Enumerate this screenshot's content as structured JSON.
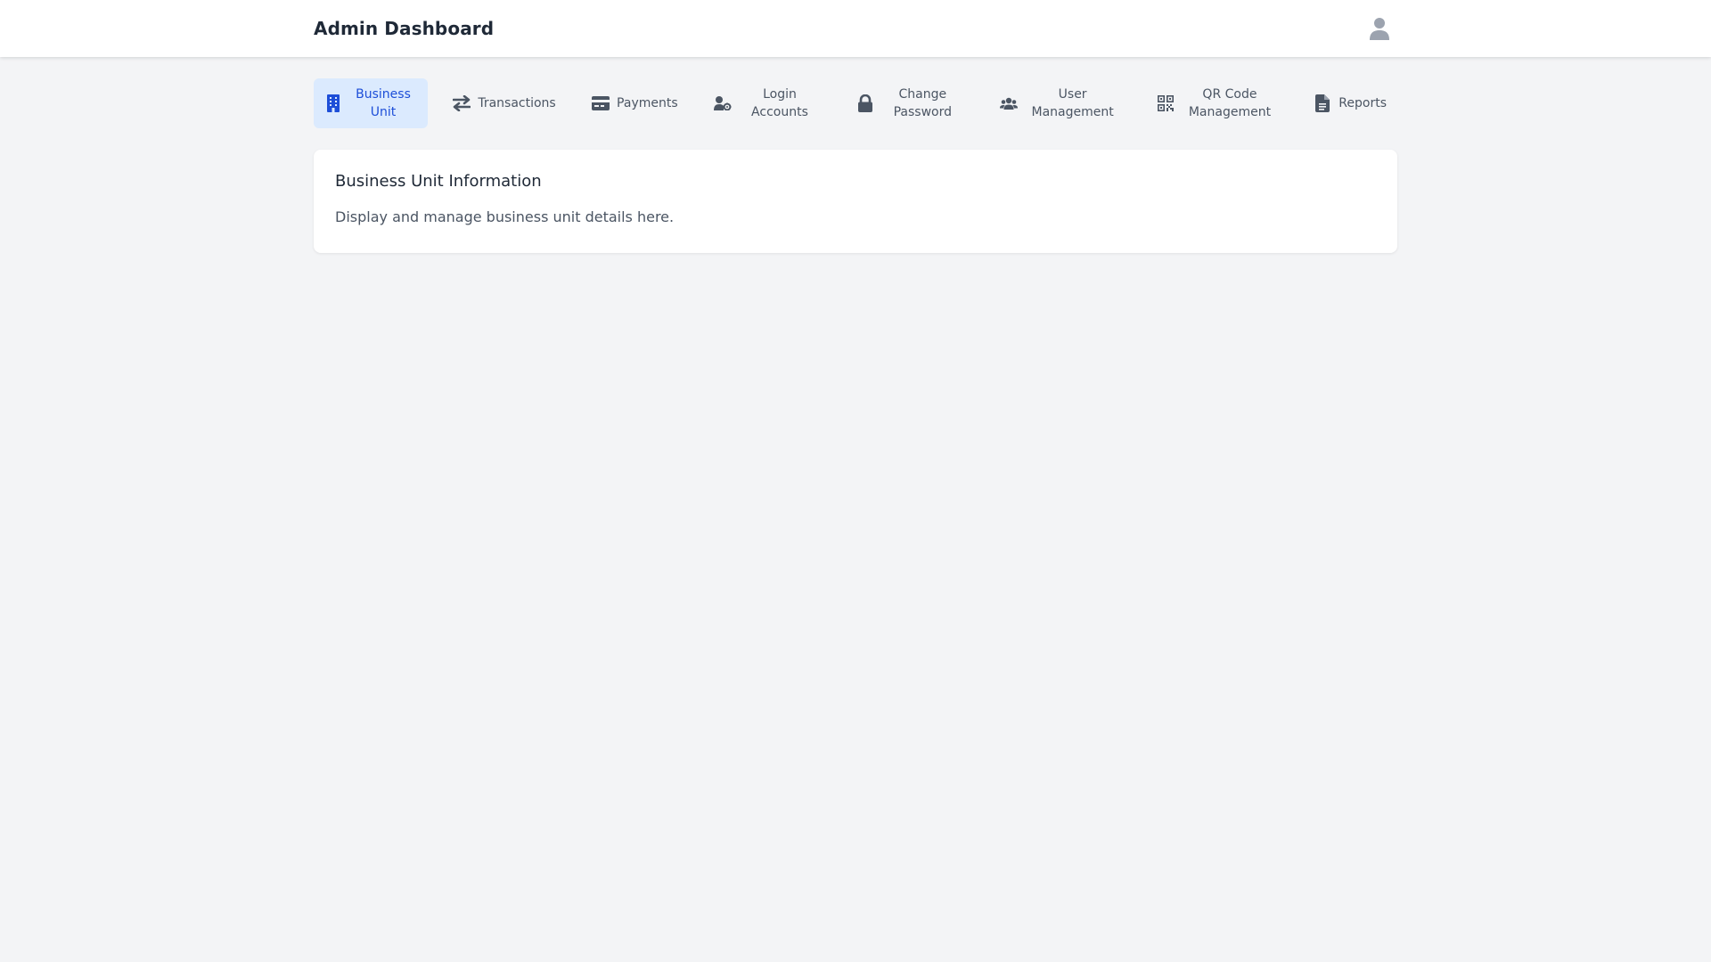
{
  "header": {
    "title": "Admin Dashboard",
    "avatar_icon": "user-icon"
  },
  "tabs": [
    {
      "label": "Business Unit",
      "icon": "building-icon",
      "active": true
    },
    {
      "label": "Transactions",
      "icon": "arrows-exchange-icon",
      "active": false
    },
    {
      "label": "Payments",
      "icon": "credit-card-icon",
      "active": false
    },
    {
      "label": "Login Accounts",
      "icon": "user-gear-icon",
      "active": false
    },
    {
      "label": "Change Password",
      "icon": "lock-icon",
      "active": false
    },
    {
      "label": "User Management",
      "icon": "users-icon",
      "active": false
    },
    {
      "label": "QR Code Management",
      "icon": "qrcode-icon",
      "active": false
    },
    {
      "label": "Reports",
      "icon": "document-icon",
      "active": false
    }
  ],
  "card": {
    "title": "Business Unit Information",
    "description": "Display and manage business unit details here."
  },
  "colors": {
    "active_tab_bg": "#dbeafe",
    "active_tab_text": "#1d4ed8",
    "page_bg": "#f3f4f6"
  }
}
